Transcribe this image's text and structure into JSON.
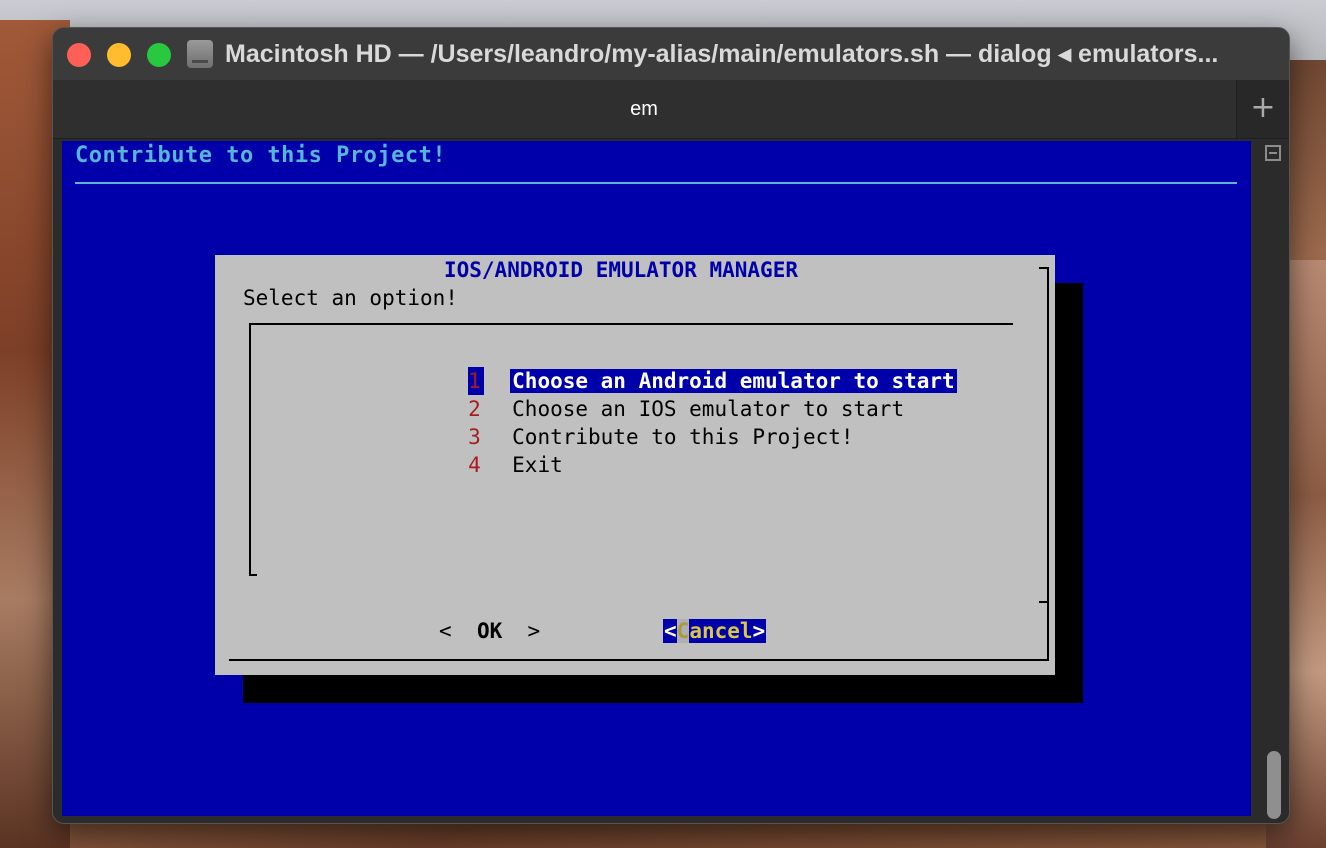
{
  "window": {
    "title": "Macintosh HD — /Users/leandro/my-alias/main/emulators.sh — dialog ◂ emulators...",
    "tab_label": "em",
    "new_tab_symbol": "+"
  },
  "terminal": {
    "backtitle": "Contribute to this Project!",
    "dialog": {
      "title": "IOS/ANDROID EMULATOR MANAGER",
      "prompt": "Select an option!",
      "items": [
        {
          "tag": "1",
          "label": "Choose an Android emulator to start",
          "selected": true
        },
        {
          "tag": "2",
          "label": "Choose an IOS emulator to start",
          "selected": false
        },
        {
          "tag": "3",
          "label": "Contribute to this Project!",
          "selected": false
        },
        {
          "tag": "4",
          "label": "Exit",
          "selected": false
        }
      ],
      "ok_left": "<",
      "ok_label": "OK",
      "ok_right": ">",
      "cancel_left": "<",
      "cancel_hotkey": "C",
      "cancel_rest": "ancel",
      "cancel_right": ">"
    }
  },
  "colors": {
    "terminal_bg": "#0000aa",
    "dialog_bg": "#c0c0c0",
    "accent_cyan": "#55b6d8",
    "tag_red": "#a61d1d"
  },
  "icons": {
    "close": "close-traffic-light",
    "minimize": "minimize-traffic-light",
    "zoom": "zoom-traffic-light",
    "disk": "hard-disk-icon"
  }
}
